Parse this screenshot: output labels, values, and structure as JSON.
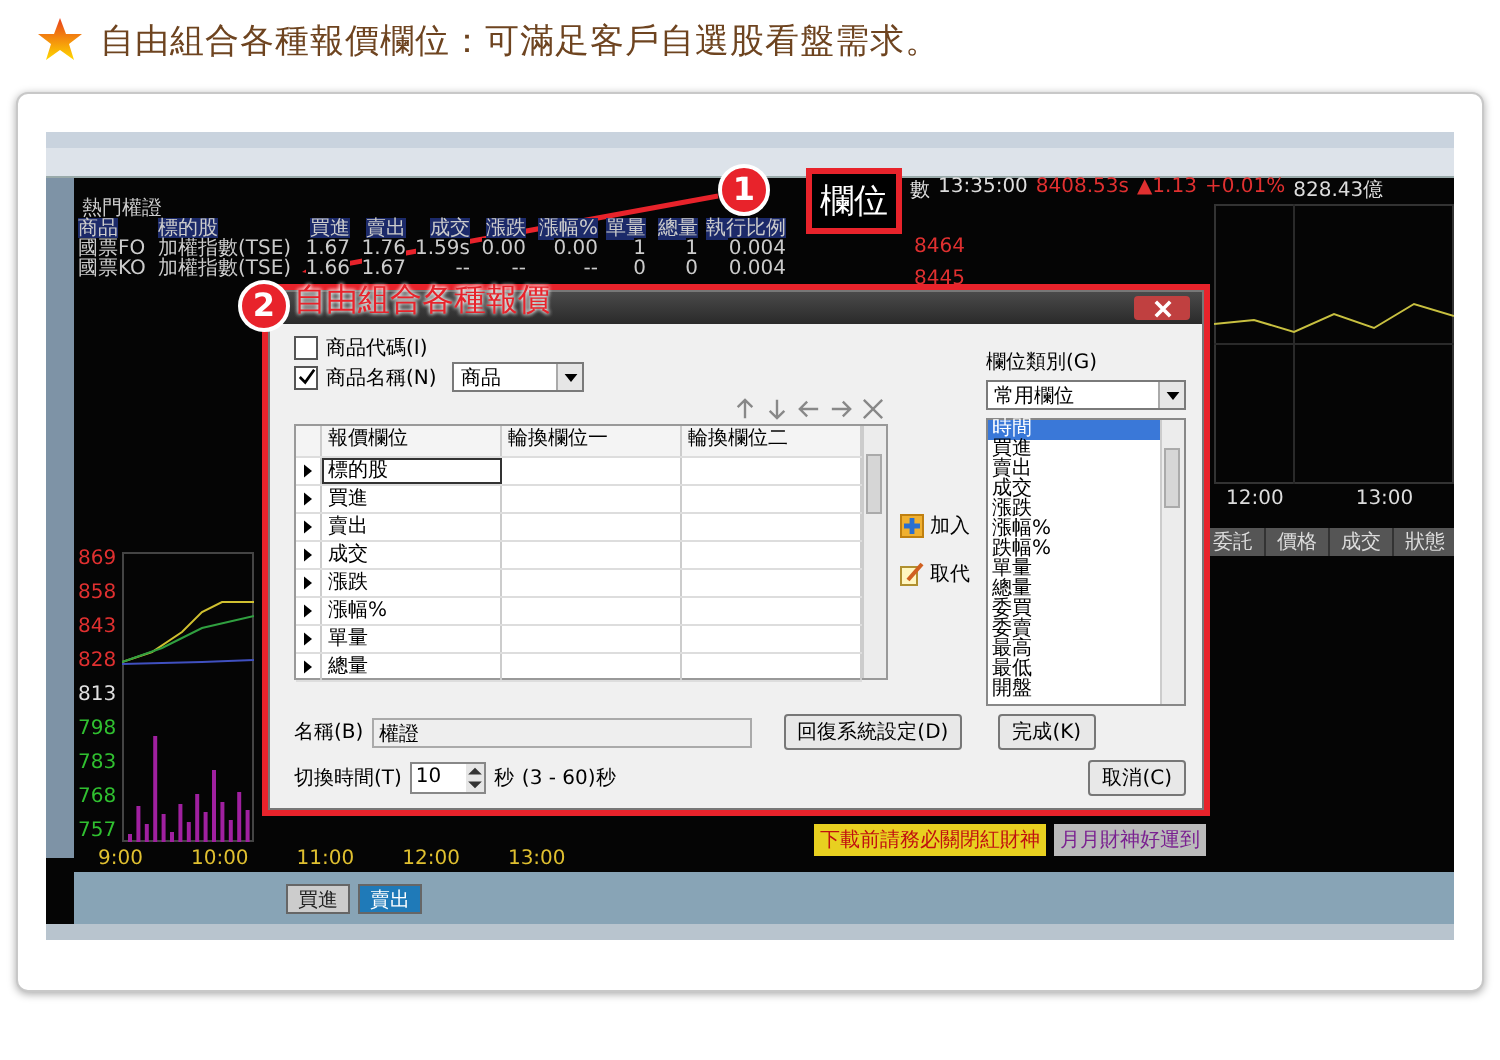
{
  "page_title": "自由組合各種報價欄位：可滿足客戶自選股看盤需求。",
  "screenshot": {
    "quote_section": "熱門權證",
    "quote_columns": [
      "商品",
      "標的股",
      "買進",
      "賣出",
      "成交",
      "漲跌",
      "漲幅%",
      "單量",
      "總量",
      "執行比例"
    ],
    "quote_rows": [
      [
        "國票FO",
        "加權指數(TSE)",
        "1.67",
        "1.76",
        "1.59s",
        "0.00",
        "0.00",
        "1",
        "1",
        "0.004"
      ],
      [
        "國票KO",
        "加權指數(TSE)",
        "1.66",
        "1.67",
        "--",
        "--",
        "--",
        "0",
        "0",
        "0.004"
      ]
    ],
    "index_line": {
      "label": "數",
      "time": "13:35:00",
      "value": "8408.53s",
      "change": "▲1.13",
      "percent": "+0.01%",
      "volume": "828.43億"
    },
    "index_ticks": [
      "8464",
      "8445"
    ],
    "index_x_ticks": [
      "12:00",
      "13:00"
    ],
    "price_y_ticks": [
      {
        "label": "869",
        "color": "#e03030"
      },
      {
        "label": "858",
        "color": "#e03030"
      },
      {
        "label": "843",
        "color": "#e03030"
      },
      {
        "label": "828",
        "color": "#e03030"
      },
      {
        "label": "813",
        "color": "#e0e0e0"
      },
      {
        "label": "798",
        "color": "#30c030"
      },
      {
        "label": "783",
        "color": "#30c030"
      },
      {
        "label": "768",
        "color": "#30c030"
      },
      {
        "label": "757",
        "color": "#30c030"
      }
    ],
    "price_x_ticks": [
      "9:00",
      "10:00",
      "11:00",
      "12:00",
      "13:00"
    ],
    "order_columns": [
      "委託",
      "價格",
      "成交",
      "狀態"
    ],
    "banners": [
      "下載前請務必關閉紅財神",
      "月月財神好運到"
    ],
    "order_buttons": [
      "買進",
      "賣出"
    ]
  },
  "dialog": {
    "code_checkbox": {
      "label": "商品代碼(I)",
      "checked": false
    },
    "name_checkbox": {
      "label": "商品名稱(N)",
      "checked": true
    },
    "name_select": "商品",
    "grid_columns": [
      "報價欄位",
      "輪換欄位一",
      "輪換欄位二"
    ],
    "grid_rows": [
      {
        "field": "標的股",
        "selected": true
      },
      {
        "field": "買進",
        "selected": false
      },
      {
        "field": "賣出",
        "selected": false
      },
      {
        "field": "成交",
        "selected": false
      },
      {
        "field": "漲跌",
        "selected": false
      },
      {
        "field": "漲幅%",
        "selected": false
      },
      {
        "field": "單量",
        "selected": false
      },
      {
        "field": "總量",
        "selected": false
      }
    ],
    "add_button": "加入",
    "replace_button": "取代",
    "category_label": "欄位類別(G)",
    "category_select": "常用欄位",
    "category_items": [
      {
        "label": "時間",
        "selected": true
      },
      {
        "label": "買進",
        "selected": false
      },
      {
        "label": "賣出",
        "selected": false
      },
      {
        "label": "成交",
        "selected": false
      },
      {
        "label": "漲跌",
        "selected": false
      },
      {
        "label": "漲幅%",
        "selected": false
      },
      {
        "label": "跌幅%",
        "selected": false
      },
      {
        "label": "單量",
        "selected": false
      },
      {
        "label": "總量",
        "selected": false
      },
      {
        "label": "委買",
        "selected": false
      },
      {
        "label": "委賣",
        "selected": false
      },
      {
        "label": "最高",
        "selected": false
      },
      {
        "label": "最低",
        "selected": false
      },
      {
        "label": "開盤",
        "selected": false
      }
    ],
    "name_label": "名稱(B)",
    "name_value": "權證",
    "restore_button": "回復系統設定(D)",
    "done_button": "完成(K)",
    "interval_label": "切換時間(T)",
    "interval_value": "10",
    "interval_unit": "秒",
    "interval_range": "(3 - 60)秒",
    "cancel_button": "取消(C)"
  },
  "callouts": [
    {
      "number": "1",
      "label": "欄位"
    },
    {
      "number": "2",
      "label": "自由組合各種報價"
    }
  ]
}
